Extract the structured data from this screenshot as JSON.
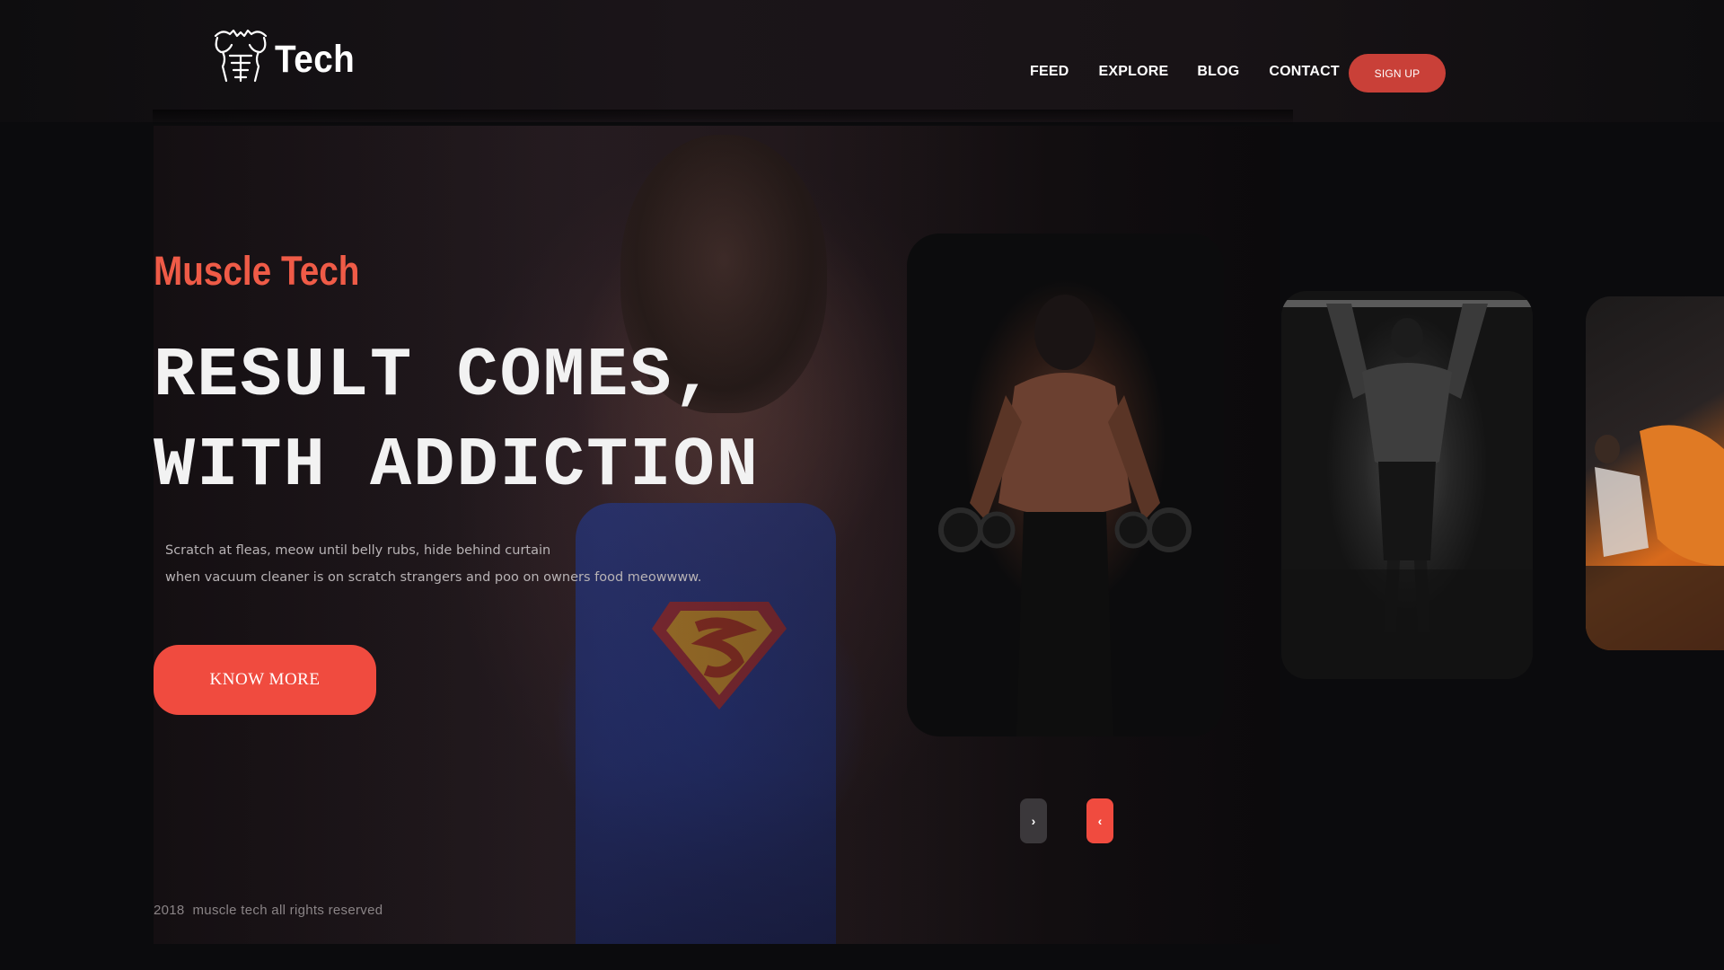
{
  "brand": {
    "logo_icon": "muscle-torso-icon",
    "name": "Tech"
  },
  "nav": {
    "items": [
      {
        "label": "FEED"
      },
      {
        "label": "EXPLORE"
      },
      {
        "label": "BLOG"
      },
      {
        "label": "CONTACT"
      }
    ],
    "signup_label": "SIGN UP"
  },
  "hero": {
    "subtitle": "Muscle Tech",
    "headline_line1": "RESULT COMES,",
    "headline_line2": "WITH ADDICTION",
    "description_line1": "Scratch at fleas, meow until belly rubs, hide behind curtain",
    "description_line2": "when vacuum cleaner is on scratch strangers and poo on owners food meowwww.",
    "cta_label": "KNOW MORE"
  },
  "slider": {
    "cards": [
      {
        "image": "bodybuilder-dumbbells-photo"
      },
      {
        "image": "pullup-back-photo"
      },
      {
        "image": "leg-press-workout-photo"
      }
    ],
    "next_icon": "chevron-right-icon",
    "prev_icon": "chevron-left-icon",
    "next_glyph": "›",
    "prev_glyph": "‹"
  },
  "footer": {
    "copyright": "2018  muscle tech all rights reserved"
  },
  "colors": {
    "accent": "#f04b3f",
    "signup": "#c94038",
    "subtitle": "#ef5b47",
    "background": "#0b0b0d"
  }
}
